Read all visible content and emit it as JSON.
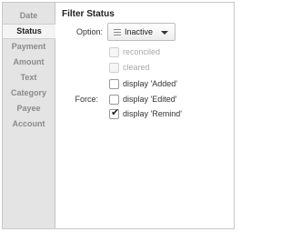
{
  "sidebar": {
    "items": [
      {
        "label": "Date"
      },
      {
        "label": "Status"
      },
      {
        "label": "Payment"
      },
      {
        "label": "Amount"
      },
      {
        "label": "Text"
      },
      {
        "label": "Category"
      },
      {
        "label": "Payee"
      },
      {
        "label": "Account"
      }
    ],
    "active": "Status"
  },
  "panel": {
    "title": "Filter Status",
    "option_label": "Option:",
    "option_value": "Inactive",
    "option_icon": "list-icon",
    "checkboxes": [
      {
        "label": "reconciled",
        "checked": false,
        "disabled": true
      },
      {
        "label": "cleared",
        "checked": false,
        "disabled": true
      }
    ],
    "force_label": "Force:",
    "force_checkboxes": [
      {
        "label": "display 'Added'",
        "checked": false,
        "disabled": false
      },
      {
        "label": "display 'Edited'",
        "checked": false,
        "disabled": false
      },
      {
        "label": "display 'Remind'",
        "checked": true,
        "disabled": false
      }
    ]
  }
}
